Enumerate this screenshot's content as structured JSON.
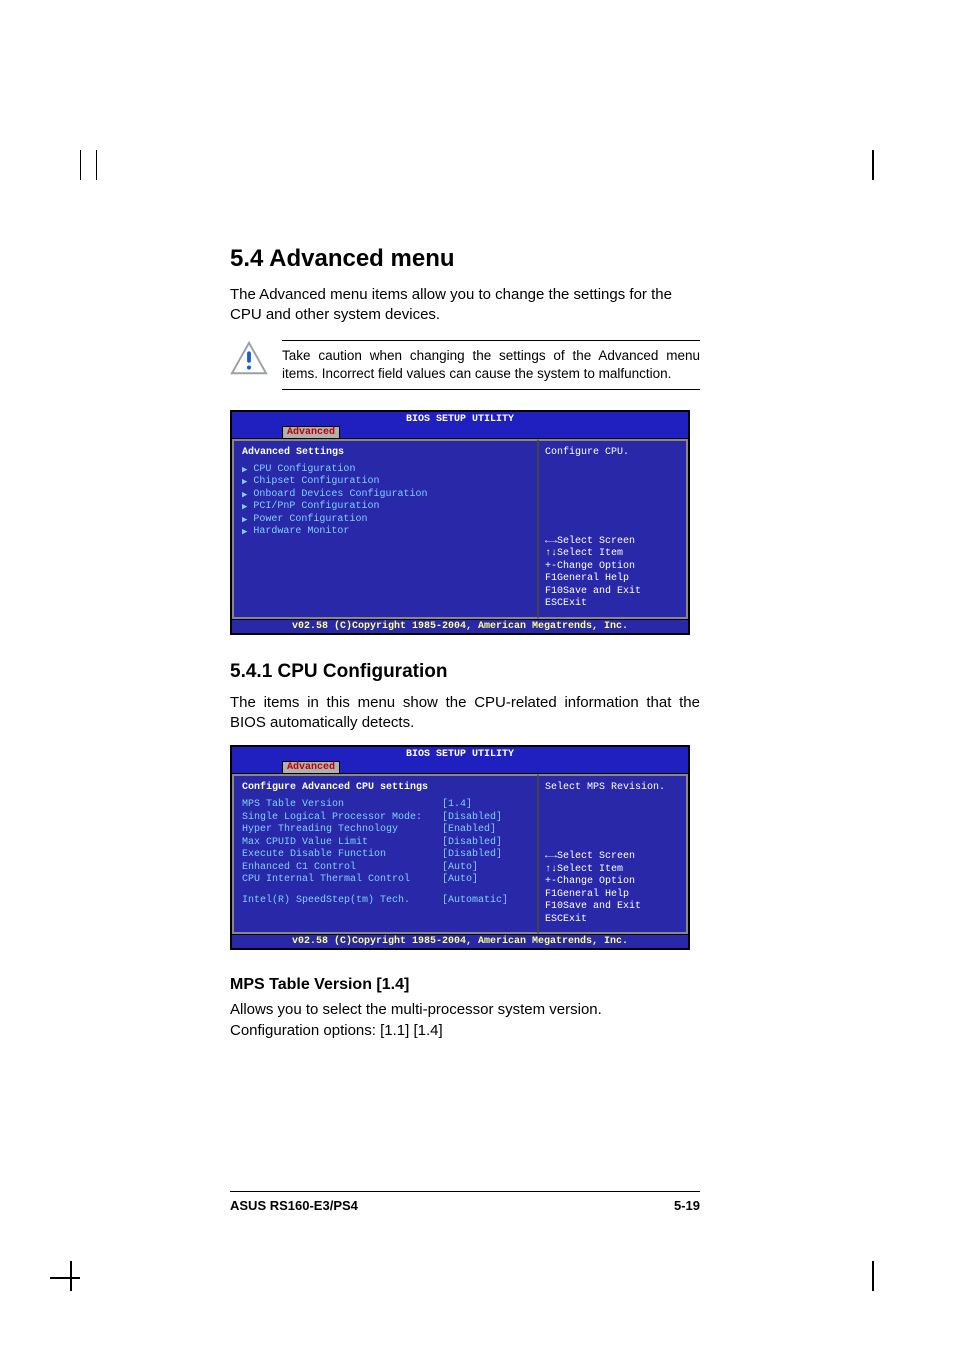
{
  "section": {
    "number_title": "5.4    Advanced menu",
    "intro": "The Advanced menu items allow you to change the settings for the CPU and other system devices.",
    "caution": "Take caution when changing the settings of the Advanced menu items. Incorrect field values can cause the system to malfunction."
  },
  "bios1": {
    "title": "BIOS SETUP UTILITY",
    "tab": "Advanced",
    "header": "Advanced Settings",
    "menu_items": [
      "CPU Configuration",
      "Chipset Configuration",
      "Onboard Devices Configuration",
      "PCI/PnP Configuration",
      "Power Configuration",
      "Hardware Monitor"
    ],
    "help": "Configure CPU.",
    "nav": [
      {
        "key": "←→",
        "label": "Select Screen"
      },
      {
        "key": "↑↓",
        "label": "Select Item"
      },
      {
        "key": "+-",
        "label": "Change Option"
      },
      {
        "key": "F1",
        "label": "General Help"
      },
      {
        "key": "F10",
        "label": "Save and Exit"
      },
      {
        "key": "ESC",
        "label": "Exit"
      }
    ],
    "footer": "v02.58 (C)Copyright 1985-2004, American Megatrends, Inc."
  },
  "subsection": {
    "number_title": "5.4.1   CPU Configuration",
    "text": "The items in this menu show the CPU-related information that the BIOS automatically detects."
  },
  "bios2": {
    "title": "BIOS SETUP UTILITY",
    "tab": "Advanced",
    "header": "Configure Advanced CPU settings",
    "settings": [
      {
        "label": "MPS Table Version",
        "value": "[1.4]"
      },
      {
        "label": "Single Logical Processor Mode:",
        "value": "[Disabled]"
      },
      {
        "label": "Hyper Threading Technology",
        "value": "[Enabled]"
      },
      {
        "label": "Max CPUID Value Limit",
        "value": "[Disabled]"
      },
      {
        "label": "Execute Disable Function",
        "value": "[Disabled]"
      },
      {
        "label": "Enhanced C1 Control",
        "value": "[Auto]"
      },
      {
        "label": "CPU Internal Thermal Control",
        "value": "[Auto]"
      }
    ],
    "extra_setting": {
      "label": "Intel(R) SpeedStep(tm) Tech.",
      "value": "[Automatic]"
    },
    "help": "Select MPS Revision.",
    "nav": [
      {
        "key": "←→",
        "label": "Select Screen"
      },
      {
        "key": "↑↓",
        "label": "Select Item"
      },
      {
        "key": "+-",
        "label": "Change Option"
      },
      {
        "key": "F1",
        "label": "General Help"
      },
      {
        "key": "F10",
        "label": "Save and Exit"
      },
      {
        "key": "ESC",
        "label": "Exit"
      }
    ],
    "footer": "v02.58 (C)Copyright 1985-2004, American Megatrends, Inc."
  },
  "param": {
    "title": "MPS Table Version [1.4]",
    "line1": "Allows you to select the multi-processor system version.",
    "line2": "Configuration options: [1.1] [1.4]"
  },
  "footer": {
    "left": "ASUS RS160-E3/PS4",
    "right": "5-19"
  }
}
